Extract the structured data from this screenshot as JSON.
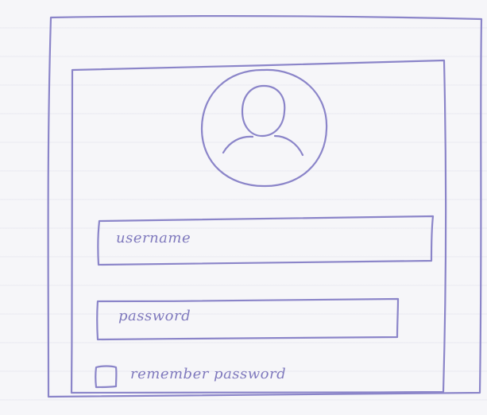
{
  "login_form": {
    "username_placeholder": "username",
    "password_placeholder": "password",
    "remember_label": "remember password"
  },
  "icons": {
    "avatar": "user-avatar-icon",
    "checkbox": "checkbox-icon"
  },
  "colors": {
    "ink": "#8b85c9",
    "paper": "#f6f6f9"
  }
}
